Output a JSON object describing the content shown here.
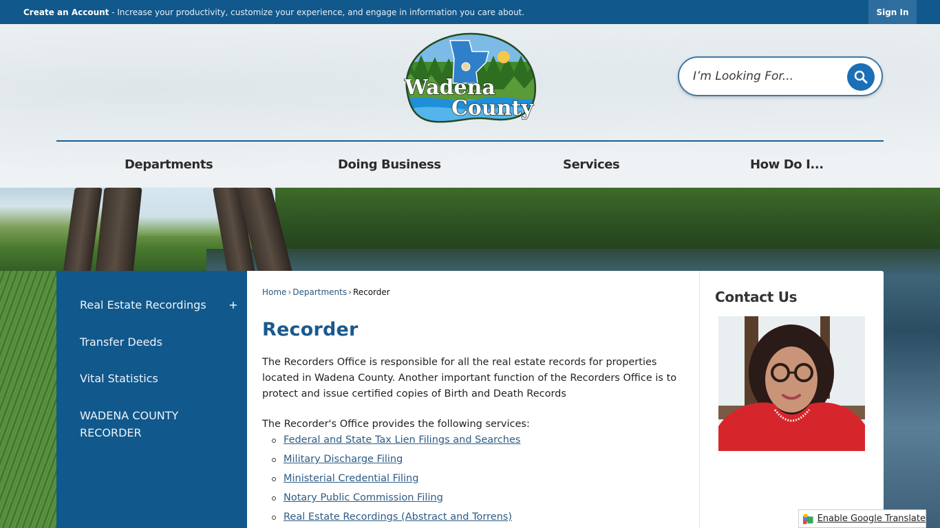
{
  "topbar": {
    "create_account_label": "Create an Account",
    "promo_text": " - Increase your productivity, customize your experience, and engage in information you care about.",
    "sign_in_label": "Sign In"
  },
  "logo": {
    "line1": "Wadena",
    "line2": "County"
  },
  "search": {
    "placeholder": "I’m Looking For..."
  },
  "nav": {
    "items": [
      {
        "label": "Departments"
      },
      {
        "label": "Doing Business"
      },
      {
        "label": "Services"
      },
      {
        "label": "How Do I..."
      }
    ]
  },
  "sidebar": {
    "items": [
      {
        "label": "Real Estate Recordings",
        "toggle": "+"
      },
      {
        "label": "Transfer Deeds"
      },
      {
        "label": "Vital Statistics"
      },
      {
        "label": "WADENA COUNTY RECORDER"
      }
    ]
  },
  "breadcrumb": {
    "items": [
      "Home",
      "Departments",
      "Recorder"
    ],
    "separator": "›"
  },
  "main": {
    "title": "Recorder",
    "intro": "The Recorders Office is responsible for all the real estate records for properties located in Wadena County.  Another important function of the Recorders Office is to protect and issue certified copies of Birth and Death Records",
    "services_intro": "The Recorder's Office provides the following services:",
    "services": [
      "Federal and State Tax Lien Filings and Searches",
      "Military Discharge Filing",
      "Ministerial Credential Filing",
      "Notary Public Commission Filing",
      "Real Estate Recordings (Abstract and Torrens)"
    ]
  },
  "contact": {
    "title": "Contact Us"
  },
  "translate": {
    "label": "Enable Google Translate"
  },
  "colors": {
    "brand_blue": "#11588c",
    "link_blue": "#2c5b85",
    "title_blue": "#19598e",
    "search_button": "#1a6fb5"
  }
}
